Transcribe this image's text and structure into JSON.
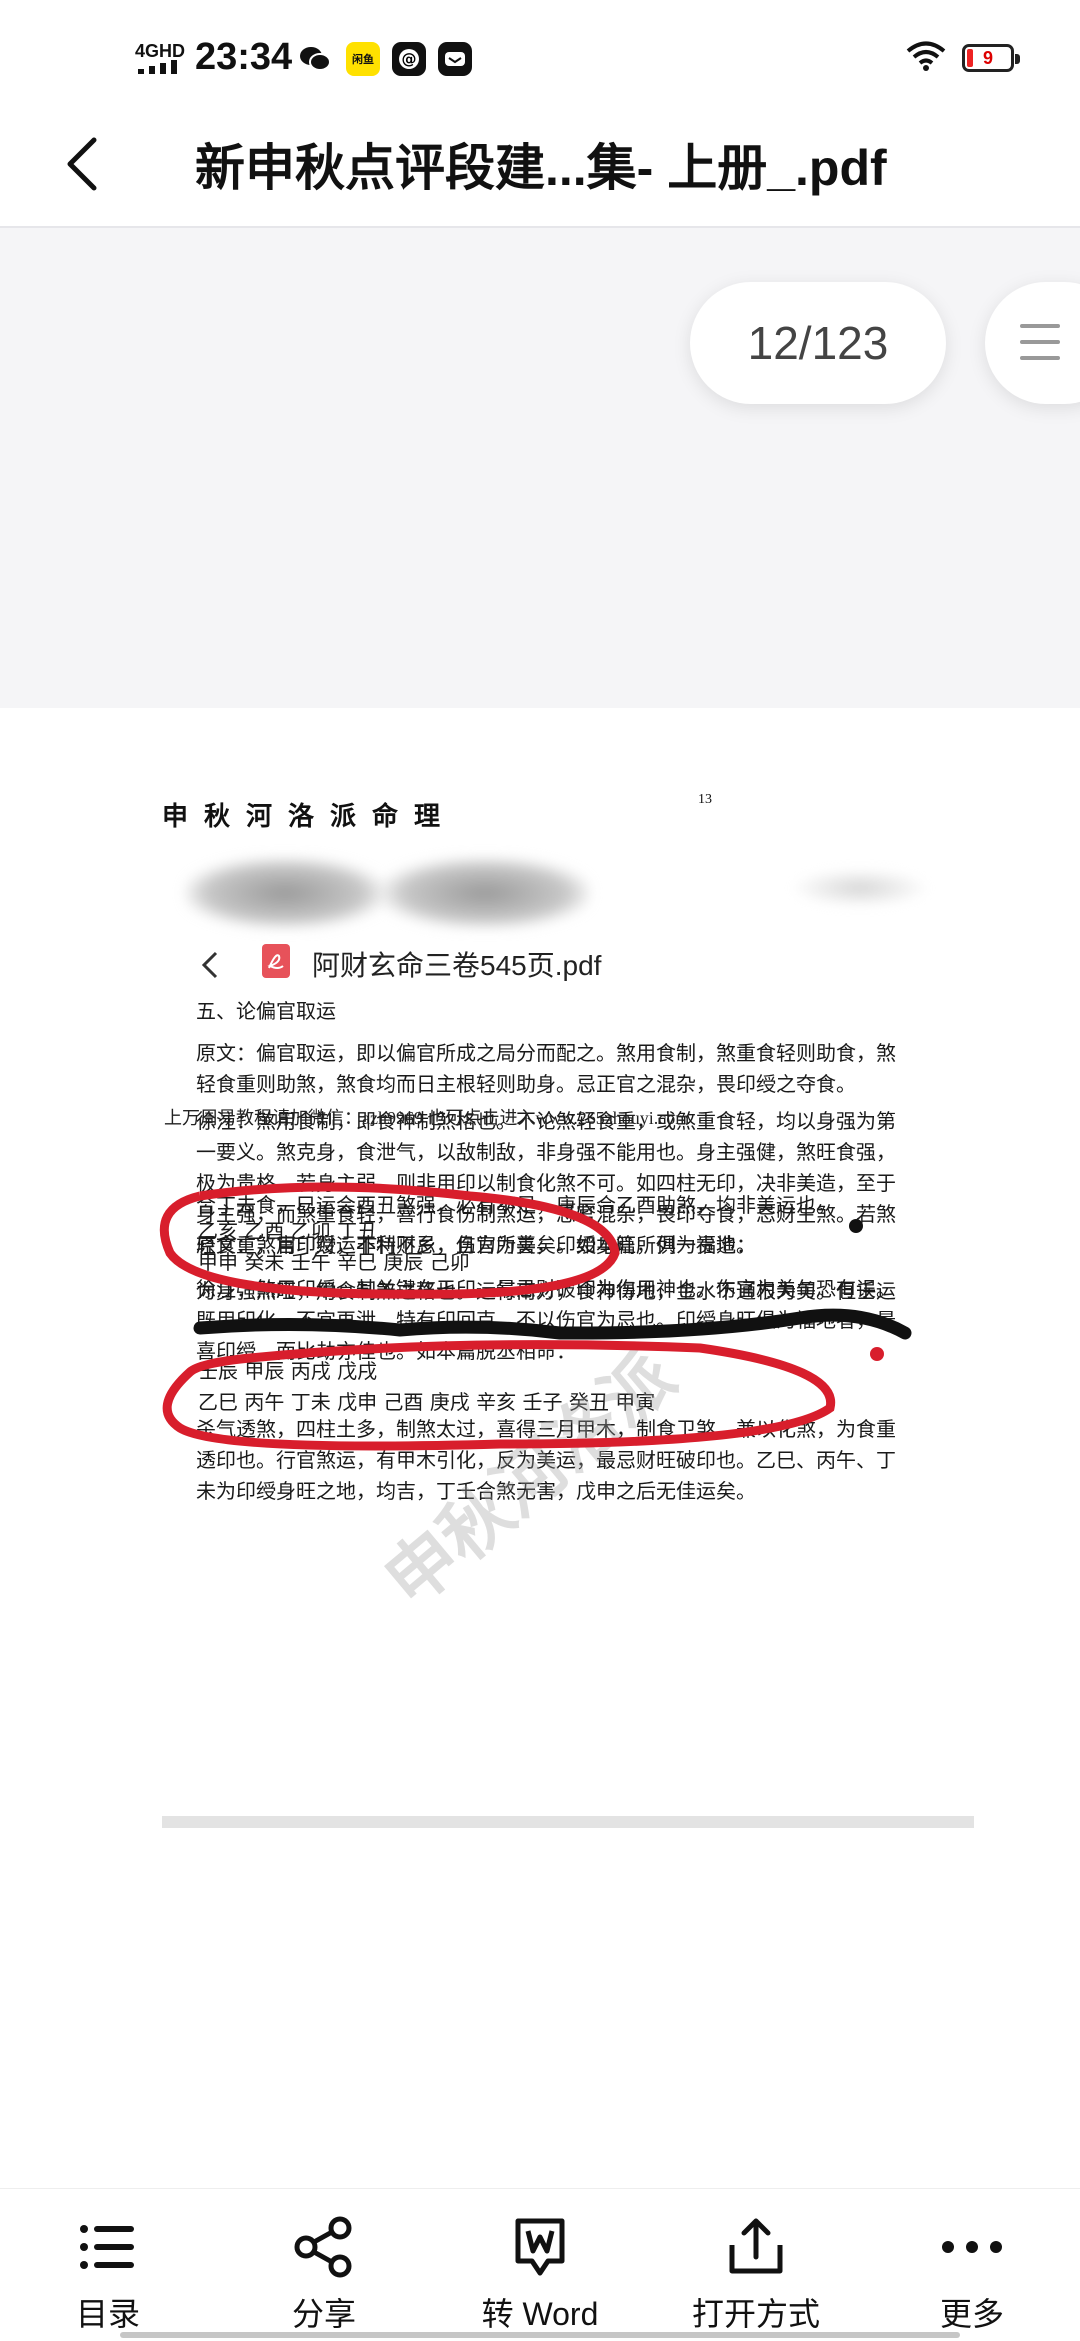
{
  "status_bar": {
    "network": "4GHD",
    "time": "23:34",
    "battery": "9",
    "app_badge": "闲鱼"
  },
  "header": {
    "title": "新申秋点评段建...集- 上册_.pdf"
  },
  "viewer": {
    "page_indicator": "12/123"
  },
  "pdf_page": {
    "book_title": "申秋河洛派命理",
    "page_number": "13",
    "inner_file_name": "阿财玄命三卷545页.pdf",
    "section_title": "五、论偏官取运",
    "paragraph1": [
      "原文：偏官取运，即以偏官所成之局分而配之。煞用食制，煞重食轻则助食，煞",
      "轻食重则助煞，煞食均而日主根轻则助身。忌正官之混杂，畏印绶之夺食。"
    ],
    "paragraph2": [
      "徐注：煞用食制，即食神制煞格也。不论煞轻食重，或煞重食轻，均以身强为第",
      "一要义。煞克身，食泄气，以敌制敌，非身强不能用也。身主强健，煞旺食强，",
      "极为贵格。若身主弱，则非用印以制食化煞不可。如四柱无印，决非美造，至于",
      "身主强，而煞重食轻，喜行食伤制煞运，忌官混杂，畏印夺食，忌财生煞。若煞",
      "轻食重，官印财运非特不忌，且为所喜矣。如本篇所列一贵造："
    ],
    "chart1": [
      "乙亥  乙酉  乙卯  丁丑",
      "甲申  癸未  壬午  辛巳  庚辰  己卯"
    ],
    "paragraph3": "为身强煞旺，用食制煞之格也。运行南方，食神得地，金水不通根为美。但壬运",
    "ad_line": "上万周易教程请加微信：azh9969    也可点击进入www.265zhouyi.com",
    "paragraph4": "合丁去食，巳运会酉丑煞强，必有不足，庚辰合乙酉助煞，均非美运也。",
    "paragraph5": "原文：煞用印绶，不利财乡，伤官为美，印绶身旺，俱为福地。",
    "paragraph6": [
      "徐注：煞用印绶，其关键在于印，最忌财破印为伤用神也。伤官为美句恐有误。",
      "既用印化，不宜再泄，特有印回克，不以伤官为忌也。印绶身旺俱为福地者，最",
      "喜印绶，而比劫亦佳也。如本篇脱丞相命："
    ],
    "chart2": [
      "壬辰  甲辰  丙戌  戊戌",
      "乙巳  丙午  丁未  戊申  己酉  庚戌  辛亥  壬子  癸丑  甲寅"
    ],
    "paragraph7": [
      "杀气透煞，四柱土多，制煞太过，喜得三月甲木，制食卫煞，兼以化煞，为食重",
      "透印也。行官煞运，有甲木引化，反为美运，最忌财旺破印也。乙巳、丙午、丁",
      "未为印绶身旺之地，均吉，丁壬合煞无害，戊申之后无佳运矣。"
    ],
    "watermark": "申秋河洛派"
  },
  "toolbar": {
    "items": [
      {
        "label": "目录",
        "icon": "list-icon"
      },
      {
        "label": "分享",
        "icon": "share-icon"
      },
      {
        "label": "转 Word",
        "icon": "word-icon"
      },
      {
        "label": "打开方式",
        "icon": "open-with-icon"
      },
      {
        "label": "更多",
        "icon": "more-icon"
      }
    ]
  },
  "colors": {
    "annotation_red": "#d81e2c",
    "pdf_icon": "#e7525a"
  }
}
